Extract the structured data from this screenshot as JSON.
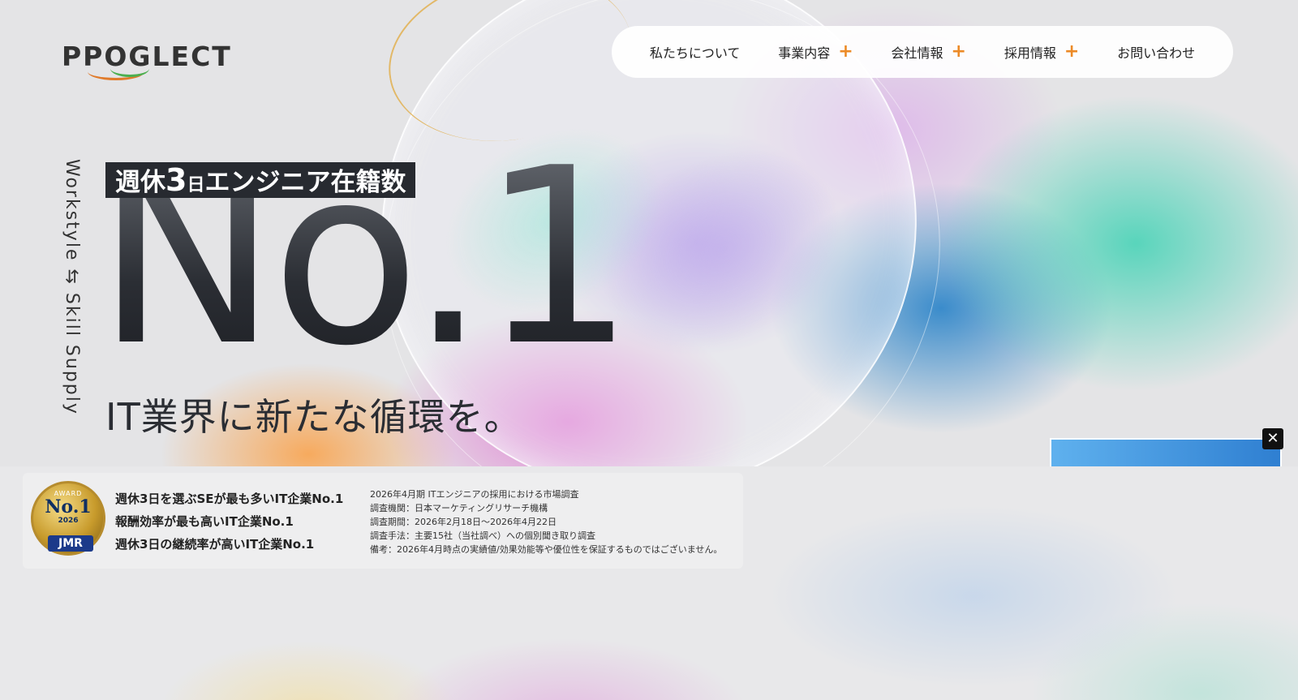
{
  "brand": {
    "logo_text": "PPOGLECT"
  },
  "nav": {
    "items": [
      {
        "label": "私たちについて",
        "has_submenu": false
      },
      {
        "label": "事業内容",
        "has_submenu": true
      },
      {
        "label": "会社情報",
        "has_submenu": true
      },
      {
        "label": "採用情報",
        "has_submenu": true
      },
      {
        "label": "お問い合わせ",
        "has_submenu": false
      }
    ],
    "submenu_symbol": "+"
  },
  "hero": {
    "vertical_text": "Workstyle ⇆ Skill Supply",
    "label_pre": "週休",
    "label_num": "3",
    "label_unit": "日",
    "label_post": "エンジニア在籍数",
    "headline": "No.1",
    "tagline": "IT業界に新たな循環を。"
  },
  "close_button": {
    "symbol": "✕"
  },
  "award": {
    "medal": {
      "award_text": "AWARD",
      "no1": "No.1",
      "year": "2026",
      "org": "JMR"
    },
    "claims": [
      "週休3日を選ぶSEが最も多いIT企業No.1",
      "報酬効率が最も高いIT企業No.1",
      "週休3日の継続率が高いIT企業No.1"
    ],
    "notes": [
      "2026年4月期 ITエンジニアの採用における市場調査",
      "調査機関：日本マーケティングリサーチ機構",
      "調査期間：2026年2月18日〜2026年4月22日",
      "調査手法：主要15社（当社調べ）への個別聞き取り調査",
      "備考：2026年4月時点の実績値/効果効能等や優位性を保証するものではございません。"
    ]
  },
  "colors": {
    "accent_plus": "#ec8a26",
    "label_bg": "#272a30",
    "text_dark": "#222222"
  }
}
